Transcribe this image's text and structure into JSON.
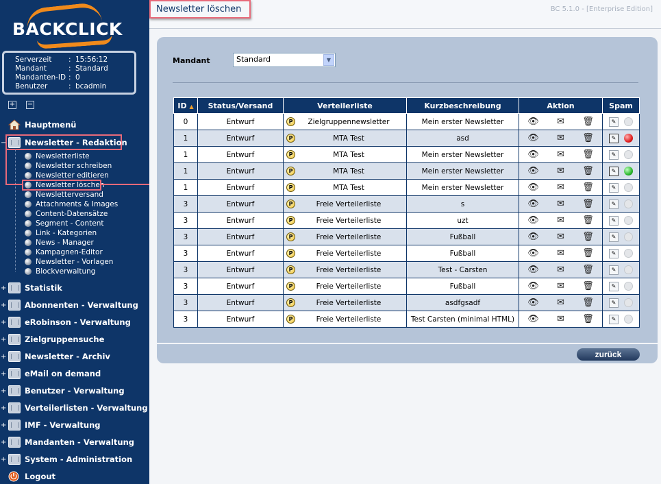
{
  "logo": {
    "text": "BACKCLICK"
  },
  "info": [
    {
      "key": "Serverzeit",
      "value": "15:56:12"
    },
    {
      "key": "Mandant",
      "value": "Standard"
    },
    {
      "key": "Mandanten-ID",
      "value": "0"
    },
    {
      "key": "Benutzer",
      "value": "bcadmin"
    }
  ],
  "controls": {
    "expand": "+",
    "collapse": "−"
  },
  "nav": {
    "hauptmenu": "Hauptmenü",
    "redaktion": "Newsletter - Redaktion",
    "sub": [
      "Newsletterliste",
      "Newsletter schreiben",
      "Newsletter editieren",
      "Newsletter löschen",
      "Newsletterversand",
      "Attachments & Images",
      "Content-Datensätze",
      "Segment - Content",
      "Link - Kategorien",
      "News - Manager",
      "Kampagnen-Editor",
      "Newsletter - Vorlagen",
      "Blockverwaltung"
    ],
    "main": [
      "Statistik",
      "Abonnenten - Verwaltung",
      "eRobinson - Verwaltung",
      "Zielgruppensuche",
      "Newsletter - Archiv",
      "eMail on demand",
      "Benutzer - Verwaltung",
      "Verteilerlisten - Verwaltung",
      "IMF - Verwaltung",
      "Mandanten - Verwaltung",
      "System - Administration"
    ],
    "logout": "Logout"
  },
  "header": {
    "title": "Newsletter löschen",
    "version": "BC 5.1.0 - [Enterprise Edition]"
  },
  "form": {
    "mandant_label": "Mandant",
    "mandant_value": "Standard"
  },
  "table": {
    "headers": [
      "ID",
      "Status/Versand",
      "Verteilerliste",
      "Kurzbeschreibung",
      "Aktion",
      "Spam"
    ],
    "sort_indicator": "▲",
    "rows": [
      {
        "id": "0",
        "status": "Entwurf",
        "liste": "Zielgruppennewsletter",
        "kurz": "Mein erster Newsletter",
        "spam": "none"
      },
      {
        "id": "1",
        "status": "Entwurf",
        "liste": "MTA Test",
        "kurz": "asd",
        "spam": "red"
      },
      {
        "id": "1",
        "status": "Entwurf",
        "liste": "MTA Test",
        "kurz": "Mein erster Newsletter",
        "spam": "none"
      },
      {
        "id": "1",
        "status": "Entwurf",
        "liste": "MTA Test",
        "kurz": "Mein erster Newsletter",
        "spam": "green"
      },
      {
        "id": "1",
        "status": "Entwurf",
        "liste": "MTA Test",
        "kurz": "Mein erster Newsletter",
        "spam": "none"
      },
      {
        "id": "3",
        "status": "Entwurf",
        "liste": "Freie Verteilerliste",
        "kurz": "s",
        "spam": "none"
      },
      {
        "id": "3",
        "status": "Entwurf",
        "liste": "Freie Verteilerliste",
        "kurz": "uzt",
        "spam": "none"
      },
      {
        "id": "3",
        "status": "Entwurf",
        "liste": "Freie Verteilerliste",
        "kurz": "Fußball",
        "spam": "none"
      },
      {
        "id": "3",
        "status": "Entwurf",
        "liste": "Freie Verteilerliste",
        "kurz": "Fußball",
        "spam": "none"
      },
      {
        "id": "3",
        "status": "Entwurf",
        "liste": "Freie Verteilerliste",
        "kurz": "Test - Carsten",
        "spam": "none"
      },
      {
        "id": "3",
        "status": "Entwurf",
        "liste": "Freie Verteilerliste",
        "kurz": "Fußball",
        "spam": "none"
      },
      {
        "id": "3",
        "status": "Entwurf",
        "liste": "Freie Verteilerliste",
        "kurz": "asdfgsadf",
        "spam": "none"
      },
      {
        "id": "3",
        "status": "Entwurf",
        "liste": "Freie Verteilerliste",
        "kurz": "Test Carsten (minimal HTML)",
        "spam": "none"
      }
    ]
  },
  "icons": {
    "p_badge": "P",
    "view": "👁",
    "copy": "✉",
    "delete": "🗑",
    "spam_doc": "✎",
    "select_arrow": "▼"
  },
  "colors": {
    "sidebar": "#0e3568",
    "panel": "#b5c4d8",
    "highlight": "#e86a7a",
    "spam_red": "#e02020",
    "spam_green": "#2db82d",
    "spam_none": "#e4e6e9"
  },
  "buttons": {
    "back": "zurück"
  }
}
